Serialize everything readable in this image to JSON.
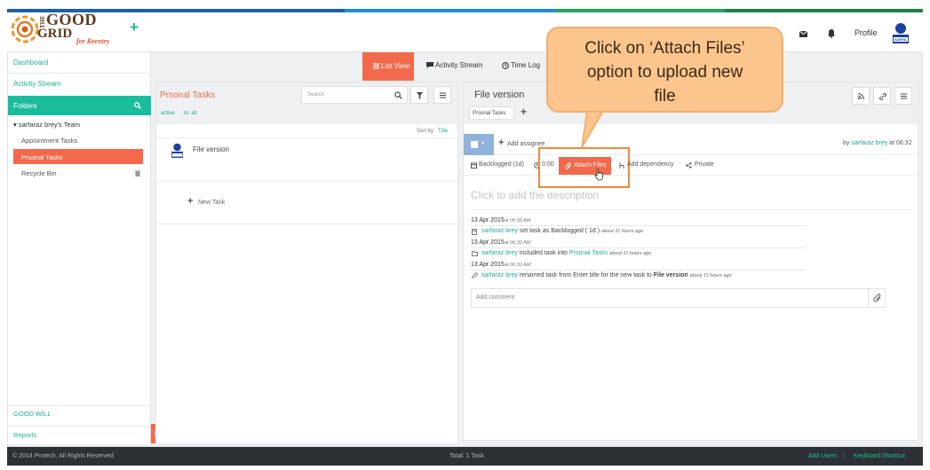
{
  "brand": {
    "line1": "THE",
    "line2": "GOOD",
    "line3": "GRID",
    "tag": "for Reentry"
  },
  "header": {
    "profile_label": "Profile",
    "avatar_label": "SARFA"
  },
  "colors": {
    "teal": "#1bbc9b",
    "orange": "#f26a4b",
    "callout": "#fcc58d"
  },
  "sidebar": {
    "dashboard": "Dashboard",
    "activity_stream": "Activity Stream",
    "folders": "Folders",
    "team": "sarfaraz brey's Team",
    "items": [
      "Appointment Tasks",
      "Prsonal Tasks",
      "Recycle Bin"
    ],
    "good_will": "GOOD WILL",
    "reports": "Reports"
  },
  "tabs": {
    "list_view": "List View",
    "activity_stream": "Activity Stream",
    "time_log": "Time Log"
  },
  "task_list": {
    "title": "Prsonal Tasks",
    "search_placeholder": "Search",
    "filter_active": "active",
    "filter_to": "to: all",
    "sort_label": "Sort by",
    "sort_value": "Title",
    "task_name": "File version",
    "new_task": "New Task"
  },
  "task_detail": {
    "title": "File version",
    "folder_tag": "Prsonal Tasks",
    "add_assignee": "Add assignee",
    "by_label": "by",
    "by_user": "sarfaraz brey",
    "by_time": "at 06:32",
    "backlogged": "Backlogged (1d)",
    "time": "0:00",
    "attach_files": "Attach Files",
    "add_dependency": "Add dependency",
    "private": "Private",
    "description_placeholder": "Click to add the description",
    "comment_placeholder": "Add comment"
  },
  "activity": [
    {
      "date": "13 Apr 2015",
      "time": "at 06:32 AM",
      "user": "sarfaraz brey",
      "pre": "set task as Backlogged ( 1d )",
      "link": "",
      "bold": "",
      "ago": "about 11 hours ago"
    },
    {
      "date": "13 Apr 2015",
      "time": "at 06:32 AM",
      "user": "sarfaraz brey",
      "pre": "included task into",
      "link": "Prsonal Tasks",
      "bold": "",
      "ago": "about 11 hours ago"
    },
    {
      "date": "13 Apr 2015",
      "time": "at 06:32 AM",
      "user": "sarfaraz brey",
      "pre": "renamed task from Enter title for the new task to",
      "link": "",
      "bold": "File version",
      "ago": "about 11 hours ago"
    }
  ],
  "footer": {
    "copyright": "© 2014 Protech, All Rights Reserved",
    "total": "Total: 1 Task",
    "add_users": "Add Users",
    "separator": "|",
    "shortcut": "Keyboard Shortcut"
  },
  "callout": {
    "line1": "Click on ‘Attach Files’",
    "line2": "option to upload new",
    "line3": "file"
  }
}
